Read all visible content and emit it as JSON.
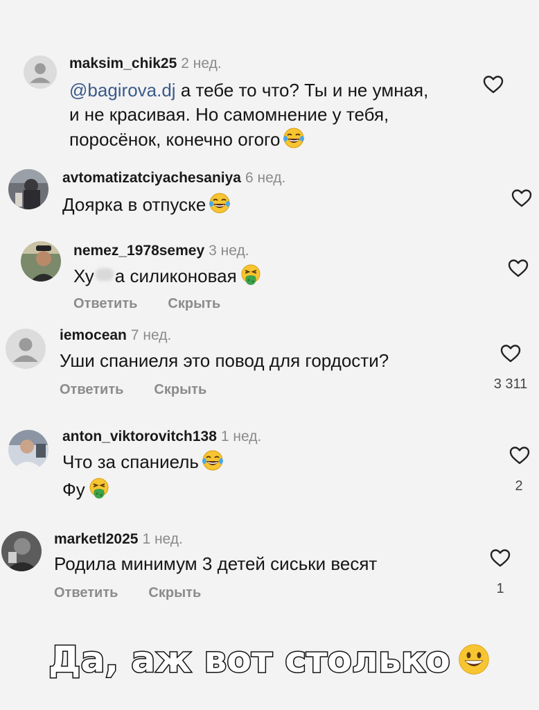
{
  "comments": [
    {
      "username": "maksim_chik25",
      "time": "2 нед.",
      "mention": "@bagirova.dj",
      "lines": [
        " а тебе то что? Ты и не умная,",
        "и не красивая. Но самомнение у тебя,",
        "поросёнок, конечно огого"
      ],
      "emoji": "laughing-tears"
    },
    {
      "username": "avtomatizatciyachesaniya",
      "time": "6 нед.",
      "lines": [
        "Доярка в отпуске"
      ],
      "emoji": "laughing-tears"
    },
    {
      "username": "nemez_1978semey",
      "time": "3 нед.",
      "lines": [
        "Ху",
        "а силиконовая"
      ],
      "emoji": "vomiting-face",
      "reply_label": "Ответить",
      "hide_label": "Скрыть"
    },
    {
      "username": "iemocean",
      "time": "7 нед.",
      "lines": [
        "Уши спаниеля это повод для гордости?"
      ],
      "reply_label": "Ответить",
      "hide_label": "Скрыть",
      "likes": "3 311"
    },
    {
      "username": "anton_viktorovitch138",
      "time": "1 нед.",
      "lines": [
        "Что за спаниель",
        "Фу"
      ],
      "emoji": "laughing-tears",
      "emoji2": "vomiting-face",
      "likes": "2"
    },
    {
      "username": "marketl2025",
      "time": "1 нед.",
      "lines": [
        "Родила минимум 3 детей сиськи весят"
      ],
      "reply_label": "Ответить",
      "hide_label": "Скрыть",
      "likes": "1"
    }
  ],
  "caption": {
    "text": "Да, аж вот столько",
    "emoji": "grinning-face"
  },
  "icons": {
    "like": "heart-outline-icon"
  }
}
